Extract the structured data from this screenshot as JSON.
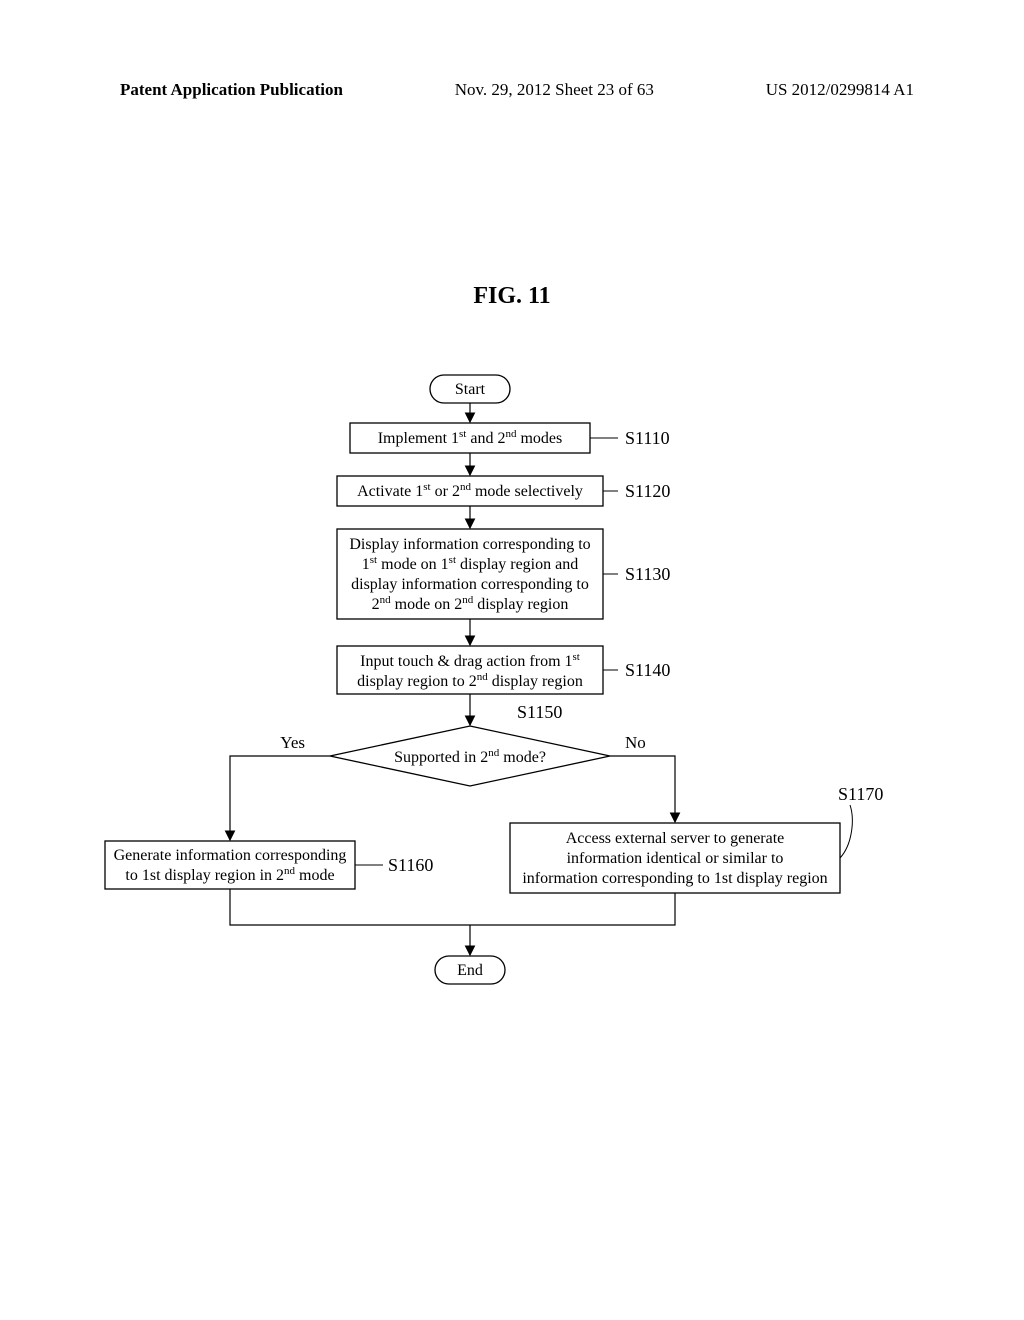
{
  "header": {
    "left": "Patent Application Publication",
    "center": "Nov. 29, 2012  Sheet 23 of 63",
    "right": "US 2012/0299814 A1"
  },
  "figure_title": "FIG. 11",
  "nodes": {
    "start": "Start",
    "end": "End",
    "s1110_pre": "Implement 1",
    "s1110_mid": " and 2",
    "s1110_post": " modes",
    "s1120_pre": "Activate 1",
    "s1120_mid": " or 2",
    "s1120_post": " mode selectively",
    "s1130_l1_pre": "Display information corresponding to",
    "s1130_l2_pre": "1",
    "s1130_l2_mid": " mode on 1",
    "s1130_l2_post": " display region and",
    "s1130_l3_pre": "display information corresponding to",
    "s1130_l4_pre": "2",
    "s1130_l4_mid": " mode on 2",
    "s1130_l4_post": " display region",
    "s1140_l1_pre": "Input touch & drag action from 1",
    "s1140_l2_pre": "display region to 2",
    "s1140_l2_post": " display region",
    "s1150_pre": "Supported in 2",
    "s1150_post": " mode?",
    "s1160_l1": "Generate information corresponding",
    "s1160_l2_pre": "to 1st display region in 2",
    "s1160_l2_post": " mode",
    "s1170_l1": "Access external server to generate",
    "s1170_l2": "information identical or similar to",
    "s1170_l3": "information corresponding to 1st display region"
  },
  "refs": {
    "s1110": "S1110",
    "s1120": "S1120",
    "s1130": "S1130",
    "s1140": "S1140",
    "s1150": "S1150",
    "s1160": "S1160",
    "s1170": "S1170"
  },
  "branches": {
    "yes": "Yes",
    "no": "No"
  },
  "sup": {
    "st": "st",
    "nd": "nd"
  }
}
